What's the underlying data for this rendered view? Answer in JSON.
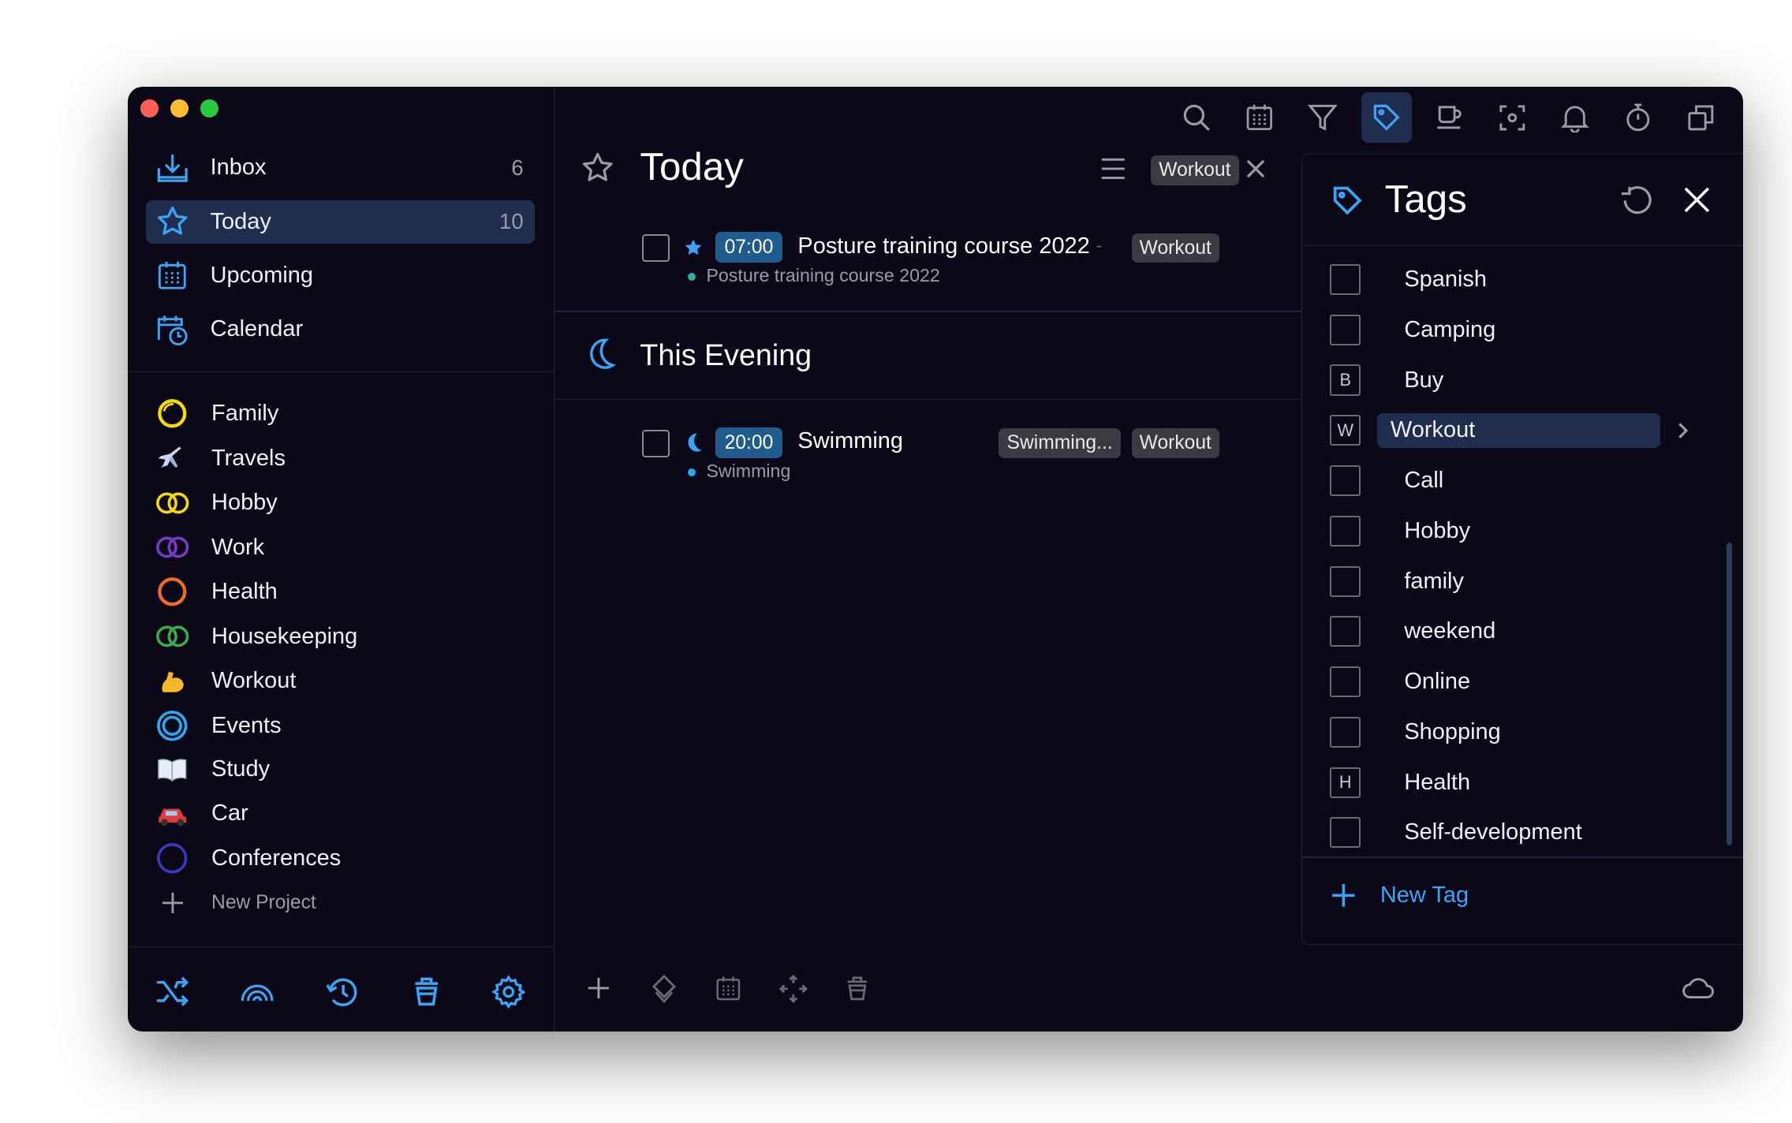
{
  "sidebar": {
    "nav": [
      {
        "label": "Inbox",
        "count": "6",
        "icon": "inbox-icon"
      },
      {
        "label": "Today",
        "count": "10",
        "icon": "star-icon",
        "active": true
      },
      {
        "label": "Upcoming",
        "count": "",
        "icon": "calendar-grid-icon"
      },
      {
        "label": "Calendar",
        "count": "",
        "icon": "calendar-clock-icon"
      }
    ],
    "projects": [
      {
        "label": "Family",
        "icon": "circle-icon",
        "color": "#f5d90a"
      },
      {
        "label": "Travels",
        "icon": "airplane-icon",
        "glyph": "✈"
      },
      {
        "label": "Hobby",
        "icon": "rings-icon",
        "color": "#f5d90a"
      },
      {
        "label": "Work",
        "icon": "rings-icon",
        "color": "#7a3ac8"
      },
      {
        "label": "Health",
        "icon": "circle-icon",
        "color": "#f06a2a"
      },
      {
        "label": "Housekeeping",
        "icon": "rings-icon",
        "color": "#3aaa4a"
      },
      {
        "label": "Workout",
        "icon": "flexed-biceps-icon",
        "glyph": "💪"
      },
      {
        "label": "Events",
        "icon": "target-circle-icon",
        "color": "#2aa8f0"
      },
      {
        "label": "Study",
        "icon": "open-book-icon",
        "glyph": "📖"
      },
      {
        "label": "Car",
        "icon": "car-icon",
        "glyph": "🚗"
      },
      {
        "label": "Conferences",
        "icon": "circle-icon",
        "color": "#3a3ac0"
      }
    ],
    "new_project_label": "New Project"
  },
  "main": {
    "title": "Today",
    "filter_chip": "Workout",
    "tasks": [
      {
        "time": "07:00",
        "title": "Posture training course 2022",
        "separator": "-",
        "subtitle": "Posture training course 2022",
        "tags": [
          "Workout"
        ]
      }
    ],
    "evening": {
      "title": "This Evening",
      "tasks": [
        {
          "time": "20:00",
          "title": "Swimming",
          "subtitle": "Swimming",
          "tags": [
            "Swimming...",
            "Workout"
          ]
        }
      ]
    }
  },
  "tags_panel": {
    "title": "Tags",
    "tags": [
      {
        "label": "Spanish",
        "key": ""
      },
      {
        "label": "Camping",
        "key": ""
      },
      {
        "label": "Buy",
        "key": "B"
      },
      {
        "label": "Workout",
        "key": "W",
        "selected": true
      },
      {
        "label": "Call",
        "key": ""
      },
      {
        "label": "Hobby",
        "key": ""
      },
      {
        "label": "family",
        "key": ""
      },
      {
        "label": "weekend",
        "key": ""
      },
      {
        "label": "Online",
        "key": ""
      },
      {
        "label": "Shopping",
        "key": ""
      },
      {
        "label": "Health",
        "key": "H"
      },
      {
        "label": "Self-development",
        "key": ""
      }
    ],
    "new_tag_label": "New Tag"
  },
  "colors": {
    "accent": "#3aa5f5",
    "selection": "#1f2d4f",
    "background": "#0b0817"
  }
}
